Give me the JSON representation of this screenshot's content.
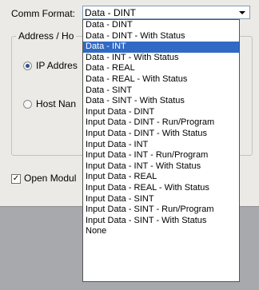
{
  "comm_format": {
    "label": "Comm Format:",
    "value": "Data - DINT"
  },
  "address_group": {
    "title": "Address / Ho",
    "ip_label": "IP Addres",
    "host_label": "Host Nan"
  },
  "open_module": {
    "label": "Open Modul",
    "checked": true
  },
  "dropdown": {
    "selected_index": 2,
    "options": [
      "Data - DINT",
      "Data - DINT - With Status",
      "Data - INT",
      "Data - INT - With Status",
      "Data - REAL",
      "Data - REAL - With Status",
      "Data - SINT",
      "Data - SINT - With Status",
      "Input Data - DINT",
      "Input Data - DINT - Run/Program",
      "Input Data - DINT - With Status",
      "Input Data - INT",
      "Input Data - INT - Run/Program",
      "Input Data - INT - With Status",
      "Input Data - REAL",
      "Input Data - REAL - With Status",
      "Input Data - SINT",
      "Input Data - SINT - Run/Program",
      "Input Data - SINT - With Status",
      "None"
    ]
  },
  "colors": {
    "highlight": "#316ac5",
    "dialog_bg": "#ebeae6"
  }
}
